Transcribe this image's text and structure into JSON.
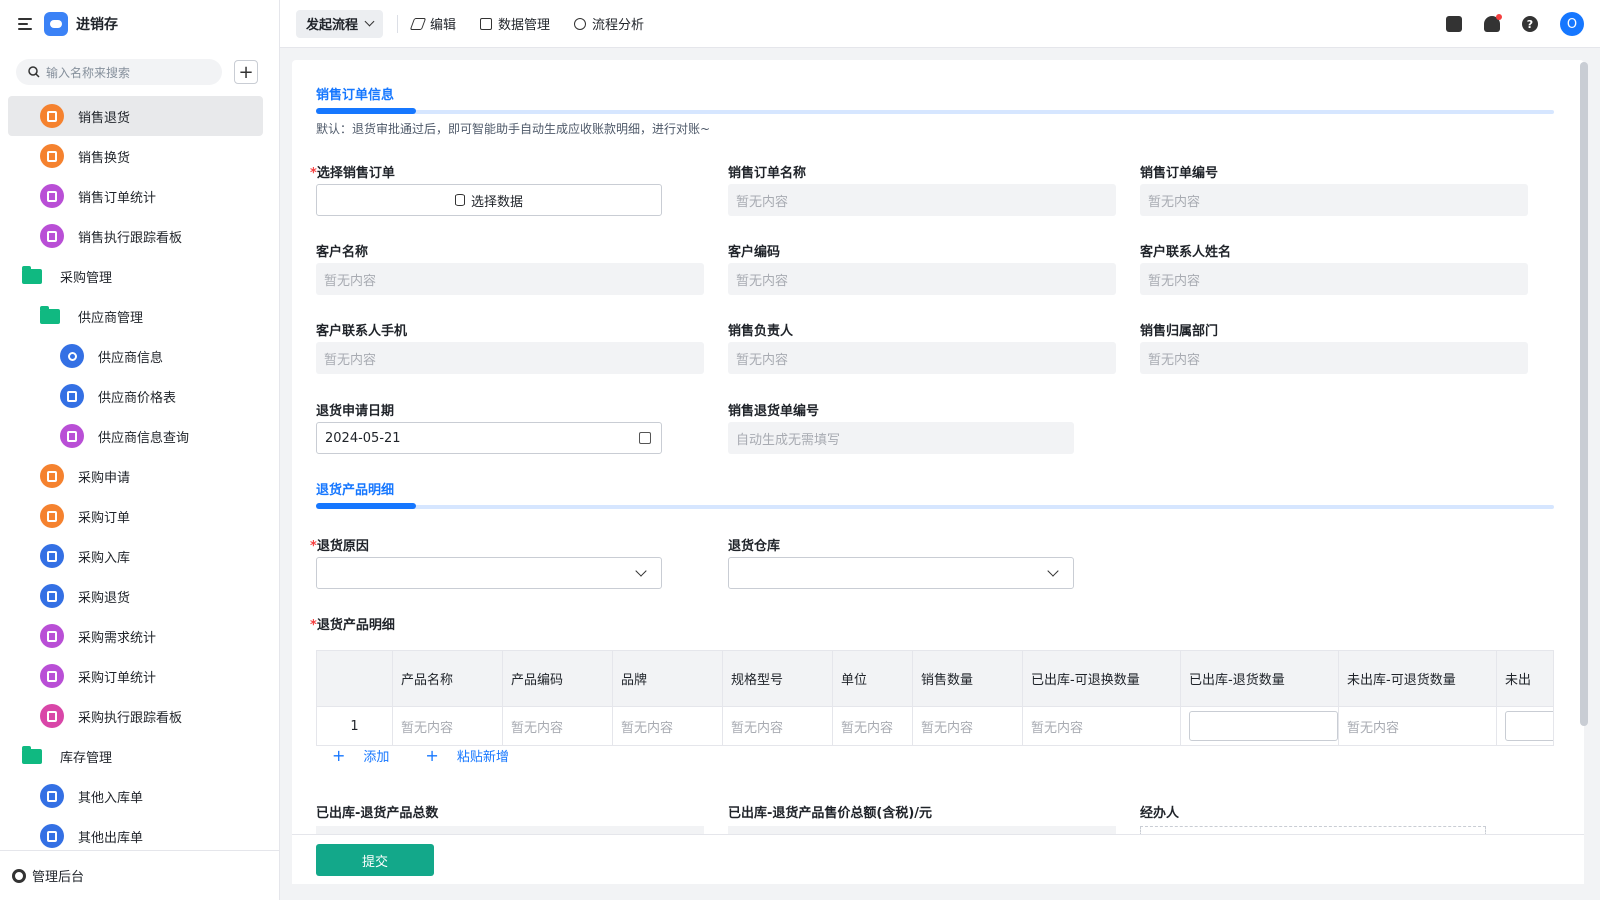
{
  "app": {
    "name": "进销存"
  },
  "search": {
    "placeholder": "输入名称来搜索"
  },
  "sidebar": {
    "items": [
      {
        "label": "销售退货",
        "icon": "form-icon",
        "color": "orange",
        "level": 1,
        "active": true
      },
      {
        "label": "销售换货",
        "icon": "form-icon",
        "color": "orange",
        "level": 1
      },
      {
        "label": "销售订单统计",
        "icon": "chart-icon",
        "color": "purple",
        "level": 1
      },
      {
        "label": "销售执行跟踪看板",
        "icon": "dashboard-icon",
        "color": "purple",
        "level": 1
      },
      {
        "label": "采购管理",
        "icon": "folder-icon",
        "color": "green",
        "level": 0,
        "folder": true
      },
      {
        "label": "供应商管理",
        "icon": "folder-icon",
        "color": "green",
        "level": 1,
        "folder": true
      },
      {
        "label": "供应商信息",
        "icon": "user-icon",
        "color": "blue",
        "level": 2
      },
      {
        "label": "供应商价格表",
        "icon": "doc-icon",
        "color": "blue",
        "level": 2
      },
      {
        "label": "供应商信息查询",
        "icon": "dashboard-icon",
        "color": "purple",
        "level": 2
      },
      {
        "label": "采购申请",
        "icon": "form-icon",
        "color": "orange",
        "level": 1
      },
      {
        "label": "采购订单",
        "icon": "form-icon",
        "color": "orange",
        "level": 1
      },
      {
        "label": "采购入库",
        "icon": "doc-icon",
        "color": "blue",
        "level": 1
      },
      {
        "label": "采购退货",
        "icon": "doc-icon",
        "color": "blue",
        "level": 1
      },
      {
        "label": "采购需求统计",
        "icon": "bar-chart-icon",
        "color": "purple",
        "level": 1
      },
      {
        "label": "采购订单统计",
        "icon": "bar-chart-icon",
        "color": "purple",
        "level": 1
      },
      {
        "label": "采购执行跟踪看板",
        "icon": "home-icon",
        "color": "pink",
        "level": 1
      },
      {
        "label": "库存管理",
        "icon": "folder-icon",
        "color": "green",
        "level": 0,
        "folder": true
      },
      {
        "label": "其他入库单",
        "icon": "doc-icon",
        "color": "blue",
        "level": 1
      },
      {
        "label": "其他出库单",
        "icon": "doc-icon",
        "color": "blue",
        "level": 1
      }
    ],
    "admin_label": "管理后台"
  },
  "topbar": {
    "flow_label": "发起流程",
    "edit_label": "编辑",
    "data_label": "数据管理",
    "analysis_label": "流程分析",
    "avatar_letter": "O",
    "help_glyph": "?"
  },
  "form": {
    "section1_title": "销售订单信息",
    "section1_note": "默认：退货审批通过后，即可智能助手自动生成应收账款明细，进行对账~",
    "select_order_label": "选择销售订单",
    "select_data_button": "选择数据",
    "order_name_label": "销售订单名称",
    "order_no_label": "销售订单编号",
    "customer_name_label": "客户名称",
    "customer_code_label": "客户编码",
    "contact_name_label": "客户联系人姓名",
    "contact_phone_label": "客户联系人手机",
    "sales_owner_label": "销售负责人",
    "sales_dept_label": "销售归属部门",
    "return_date_label": "退货申请日期",
    "return_date_value": "2024-05-21",
    "return_no_label": "销售退货单编号",
    "return_no_placeholder": "自动生成无需填写",
    "empty": "暂无内容",
    "section2_title": "退货产品明细",
    "reason_label": "退货原因",
    "warehouse_label": "退货仓库",
    "detail_label": "退货产品明细",
    "columns": [
      "",
      "产品名称",
      "产品编码",
      "品牌",
      "规格型号",
      "单位",
      "销售数量",
      "已出库-可退换数量",
      "已出库-退货数量",
      "未出库-可退货数量",
      "未出"
    ],
    "row": {
      "index": "1",
      "cells": [
        "暂无内容",
        "暂无内容",
        "暂无内容",
        "暂无内容",
        "暂无内容",
        "暂无内容",
        "暂无内容",
        "",
        "暂无内容",
        ""
      ]
    },
    "add_label": "添加",
    "paste_label": "粘贴新增",
    "total_qty_label": "已出库-退货产品总数",
    "total_amount_label": "已出库-退货产品售价总额(含税)/元",
    "handler_label": "经办人",
    "submit_label": "提交"
  },
  "colors": {
    "accent": "#1677ff",
    "submit": "#13a88a",
    "required": "#f53f3f"
  }
}
